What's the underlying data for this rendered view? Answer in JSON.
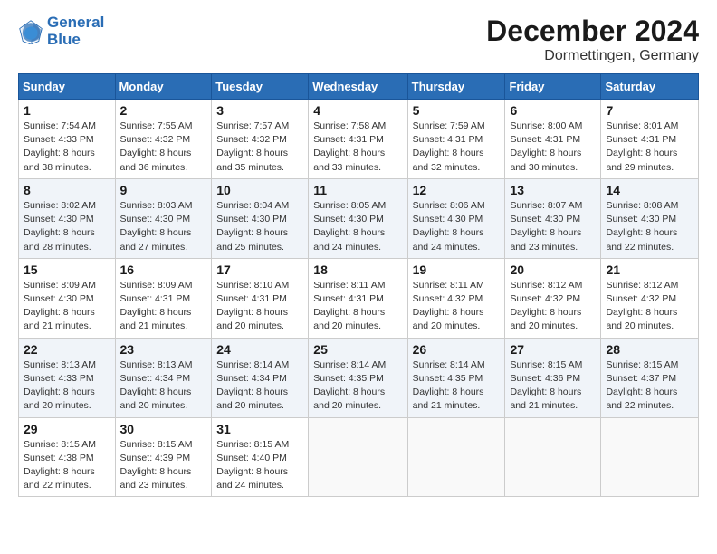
{
  "logo": {
    "line1": "General",
    "line2": "Blue"
  },
  "title": "December 2024",
  "location": "Dormettingen, Germany",
  "days_of_week": [
    "Sunday",
    "Monday",
    "Tuesday",
    "Wednesday",
    "Thursday",
    "Friday",
    "Saturday"
  ],
  "weeks": [
    [
      {
        "day": "1",
        "info": "Sunrise: 7:54 AM\nSunset: 4:33 PM\nDaylight: 8 hours\nand 38 minutes."
      },
      {
        "day": "2",
        "info": "Sunrise: 7:55 AM\nSunset: 4:32 PM\nDaylight: 8 hours\nand 36 minutes."
      },
      {
        "day": "3",
        "info": "Sunrise: 7:57 AM\nSunset: 4:32 PM\nDaylight: 8 hours\nand 35 minutes."
      },
      {
        "day": "4",
        "info": "Sunrise: 7:58 AM\nSunset: 4:31 PM\nDaylight: 8 hours\nand 33 minutes."
      },
      {
        "day": "5",
        "info": "Sunrise: 7:59 AM\nSunset: 4:31 PM\nDaylight: 8 hours\nand 32 minutes."
      },
      {
        "day": "6",
        "info": "Sunrise: 8:00 AM\nSunset: 4:31 PM\nDaylight: 8 hours\nand 30 minutes."
      },
      {
        "day": "7",
        "info": "Sunrise: 8:01 AM\nSunset: 4:31 PM\nDaylight: 8 hours\nand 29 minutes."
      }
    ],
    [
      {
        "day": "8",
        "info": "Sunrise: 8:02 AM\nSunset: 4:30 PM\nDaylight: 8 hours\nand 28 minutes."
      },
      {
        "day": "9",
        "info": "Sunrise: 8:03 AM\nSunset: 4:30 PM\nDaylight: 8 hours\nand 27 minutes."
      },
      {
        "day": "10",
        "info": "Sunrise: 8:04 AM\nSunset: 4:30 PM\nDaylight: 8 hours\nand 25 minutes."
      },
      {
        "day": "11",
        "info": "Sunrise: 8:05 AM\nSunset: 4:30 PM\nDaylight: 8 hours\nand 24 minutes."
      },
      {
        "day": "12",
        "info": "Sunrise: 8:06 AM\nSunset: 4:30 PM\nDaylight: 8 hours\nand 24 minutes."
      },
      {
        "day": "13",
        "info": "Sunrise: 8:07 AM\nSunset: 4:30 PM\nDaylight: 8 hours\nand 23 minutes."
      },
      {
        "day": "14",
        "info": "Sunrise: 8:08 AM\nSunset: 4:30 PM\nDaylight: 8 hours\nand 22 minutes."
      }
    ],
    [
      {
        "day": "15",
        "info": "Sunrise: 8:09 AM\nSunset: 4:30 PM\nDaylight: 8 hours\nand 21 minutes."
      },
      {
        "day": "16",
        "info": "Sunrise: 8:09 AM\nSunset: 4:31 PM\nDaylight: 8 hours\nand 21 minutes."
      },
      {
        "day": "17",
        "info": "Sunrise: 8:10 AM\nSunset: 4:31 PM\nDaylight: 8 hours\nand 20 minutes."
      },
      {
        "day": "18",
        "info": "Sunrise: 8:11 AM\nSunset: 4:31 PM\nDaylight: 8 hours\nand 20 minutes."
      },
      {
        "day": "19",
        "info": "Sunrise: 8:11 AM\nSunset: 4:32 PM\nDaylight: 8 hours\nand 20 minutes."
      },
      {
        "day": "20",
        "info": "Sunrise: 8:12 AM\nSunset: 4:32 PM\nDaylight: 8 hours\nand 20 minutes."
      },
      {
        "day": "21",
        "info": "Sunrise: 8:12 AM\nSunset: 4:32 PM\nDaylight: 8 hours\nand 20 minutes."
      }
    ],
    [
      {
        "day": "22",
        "info": "Sunrise: 8:13 AM\nSunset: 4:33 PM\nDaylight: 8 hours\nand 20 minutes."
      },
      {
        "day": "23",
        "info": "Sunrise: 8:13 AM\nSunset: 4:34 PM\nDaylight: 8 hours\nand 20 minutes."
      },
      {
        "day": "24",
        "info": "Sunrise: 8:14 AM\nSunset: 4:34 PM\nDaylight: 8 hours\nand 20 minutes."
      },
      {
        "day": "25",
        "info": "Sunrise: 8:14 AM\nSunset: 4:35 PM\nDaylight: 8 hours\nand 20 minutes."
      },
      {
        "day": "26",
        "info": "Sunrise: 8:14 AM\nSunset: 4:35 PM\nDaylight: 8 hours\nand 21 minutes."
      },
      {
        "day": "27",
        "info": "Sunrise: 8:15 AM\nSunset: 4:36 PM\nDaylight: 8 hours\nand 21 minutes."
      },
      {
        "day": "28",
        "info": "Sunrise: 8:15 AM\nSunset: 4:37 PM\nDaylight: 8 hours\nand 22 minutes."
      }
    ],
    [
      {
        "day": "29",
        "info": "Sunrise: 8:15 AM\nSunset: 4:38 PM\nDaylight: 8 hours\nand 22 minutes."
      },
      {
        "day": "30",
        "info": "Sunrise: 8:15 AM\nSunset: 4:39 PM\nDaylight: 8 hours\nand 23 minutes."
      },
      {
        "day": "31",
        "info": "Sunrise: 8:15 AM\nSunset: 4:40 PM\nDaylight: 8 hours\nand 24 minutes."
      },
      {
        "day": "",
        "info": ""
      },
      {
        "day": "",
        "info": ""
      },
      {
        "day": "",
        "info": ""
      },
      {
        "day": "",
        "info": ""
      }
    ]
  ]
}
